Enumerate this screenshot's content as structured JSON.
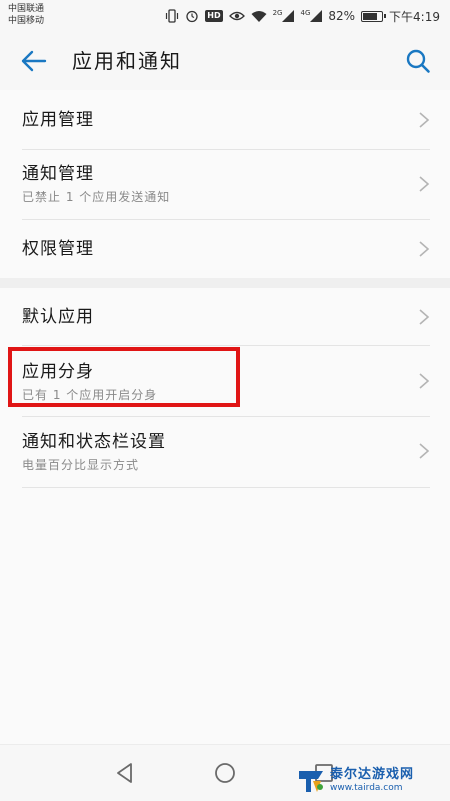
{
  "status_bar": {
    "carrier_1": "中国联通",
    "carrier_2": "中国移动",
    "hd_label": "HD",
    "network_1": "2G",
    "network_2": "4G",
    "battery_text": "82%",
    "battery_level": 0.82,
    "time": "下午4:19"
  },
  "header": {
    "title": "应用和通知"
  },
  "groups": [
    {
      "items": [
        {
          "title": "应用管理",
          "subtitle": ""
        },
        {
          "title": "通知管理",
          "subtitle": "已禁止 1 个应用发送通知"
        },
        {
          "title": "权限管理",
          "subtitle": ""
        }
      ]
    },
    {
      "items": [
        {
          "title": "默认应用",
          "subtitle": ""
        },
        {
          "title": "应用分身",
          "subtitle": "已有 1 个应用开启分身"
        },
        {
          "title": "通知和状态栏设置",
          "subtitle": "电量百分比显示方式"
        }
      ]
    }
  ],
  "watermark": {
    "name": "泰尔达游戏网",
    "url": "www.tairda.com"
  },
  "colors": {
    "accent": "#1a78c2",
    "highlight": "#e01515"
  }
}
